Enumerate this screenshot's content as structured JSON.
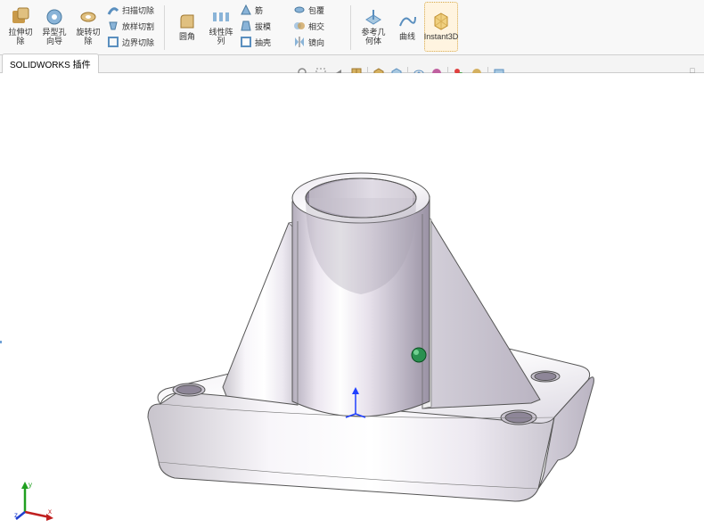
{
  "ribbon": {
    "groups": [
      {
        "large": [
          {
            "name": "extruded-cut-button",
            "label": "拉伸切\n除",
            "icon": "#c99a4a"
          },
          {
            "name": "hole-wizard-button",
            "label": "异型孔\n向导",
            "icon": "#5a8fbf"
          },
          {
            "name": "revolved-cut-button",
            "label": "旋转切\n除",
            "icon": "#c99a4a"
          }
        ],
        "small": [
          {
            "name": "swept-cut-button",
            "label": "扫描切除",
            "icon": "#7aa8cc"
          },
          {
            "name": "lofted-cut-button",
            "label": "放样切割",
            "icon": "#7aa8cc"
          },
          {
            "name": "boundary-cut-button",
            "label": "边界切除",
            "icon": "#7aa8cc"
          }
        ]
      },
      {
        "large": [
          {
            "name": "fillet-button",
            "label": "圆角",
            "icon": "#c99a4a"
          },
          {
            "name": "linear-pattern-button",
            "label": "线性阵\n列",
            "icon": "#5a8fbf"
          }
        ],
        "small": [
          {
            "name": "rib-button",
            "label": "筋",
            "icon": "#7aa8cc"
          },
          {
            "name": "draft-button",
            "label": "拔模",
            "icon": "#7aa8cc"
          },
          {
            "name": "shell-button",
            "label": "抽壳",
            "icon": "#7aa8cc"
          }
        ],
        "small2": [
          {
            "name": "wrap-button",
            "label": "包覆",
            "icon": "#7aa8cc"
          },
          {
            "name": "intersect-button",
            "label": "相交",
            "icon": "#7aa8cc"
          },
          {
            "name": "mirror-button",
            "label": "镜向",
            "icon": "#7aa8cc"
          }
        ]
      },
      {
        "large": [
          {
            "name": "ref-geometry-button",
            "label": "参考几\n何体",
            "icon": "#5a8fbf"
          },
          {
            "name": "curves-button",
            "label": "曲线",
            "icon": "#5a8fbf"
          },
          {
            "name": "instant3d-button",
            "label": "Instant3D",
            "icon": "#d6a84a"
          }
        ]
      }
    ]
  },
  "tabs": {
    "active": "SOLIDWORKS 插件"
  },
  "headsup": {
    "buttons": [
      "zoom-to-fit-icon",
      "zoom-area-icon",
      "prev-view-icon",
      "section-view-icon",
      "view-orient-icon",
      "display-style-icon",
      "hide-show-icon",
      "edit-appearance-icon",
      "apply-scene-icon",
      "view-settings-icon",
      "render-settings-icon",
      "display-ctl-icon"
    ],
    "expand_hint": "□"
  },
  "triad": {
    "x": "x",
    "y": "y",
    "z": "z"
  }
}
